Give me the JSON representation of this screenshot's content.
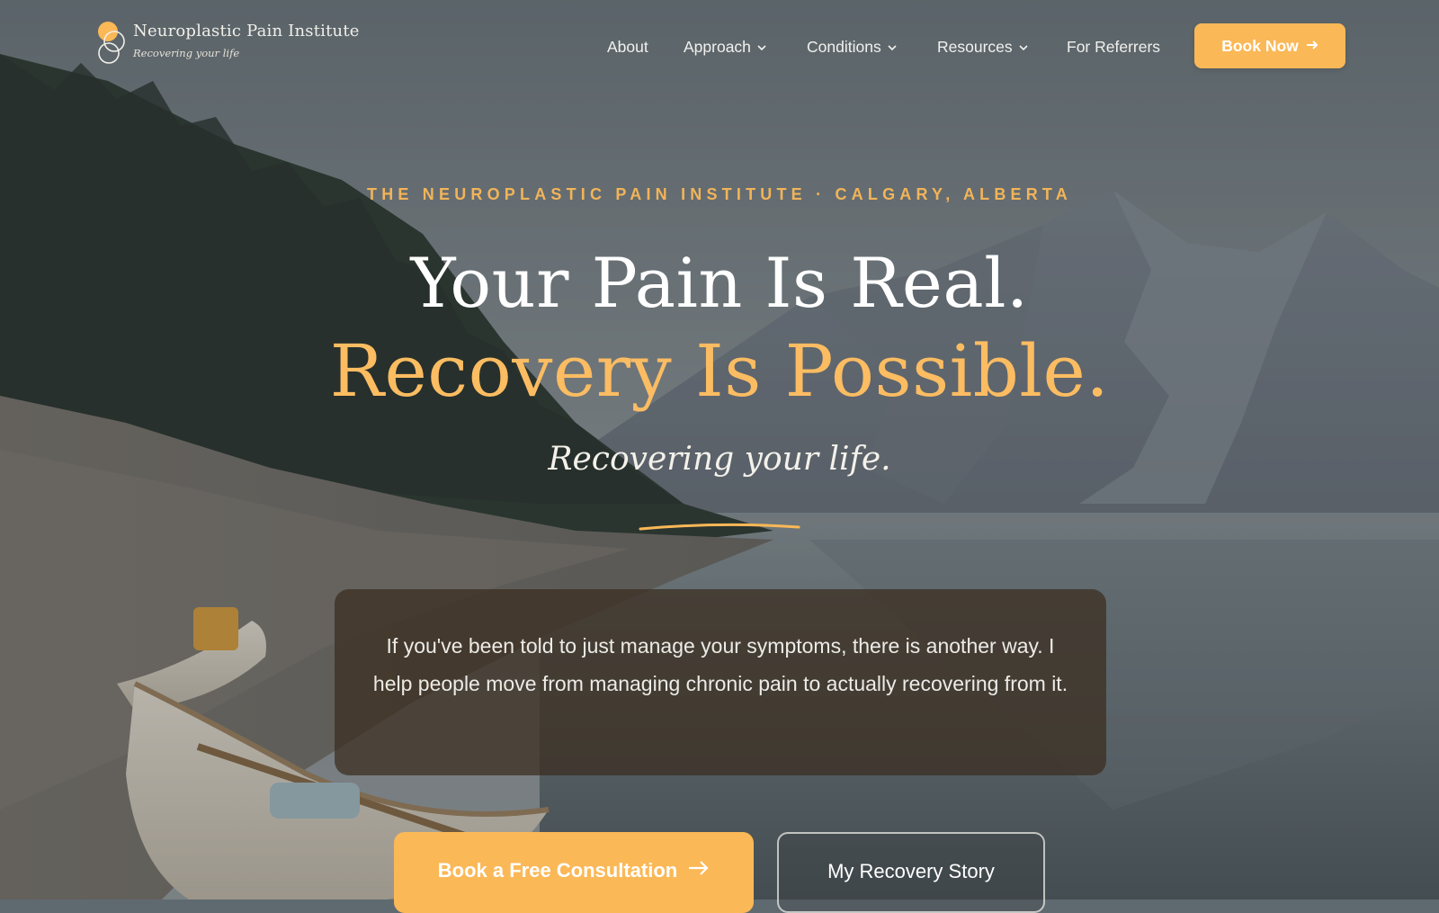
{
  "brand": {
    "name": "Neuroplastic Pain Institute",
    "tagline": "Recovering your life",
    "logo_colors": [
      "#fbb857",
      "#f1efe9"
    ]
  },
  "nav": {
    "items": [
      {
        "label": "About",
        "has_dropdown": false
      },
      {
        "label": "Approach",
        "has_dropdown": true
      },
      {
        "label": "Conditions",
        "has_dropdown": true
      },
      {
        "label": "Resources",
        "has_dropdown": true
      },
      {
        "label": "For Referrers",
        "has_dropdown": false
      }
    ],
    "book_now_label": "Book Now",
    "book_now_icon": "arrow-right-icon"
  },
  "hero": {
    "eyebrow": "THE NEUROPLASTIC PAIN INSTITUTE · CALGARY, ALBERTA",
    "headline_line1": "Your Pain Is Real.",
    "headline_line2": "Recovery Is Possible.",
    "tagline": "Recovering your life.",
    "intro": "If you've been told to just manage your symptoms, there is another way. I help people move from managing chronic pain to actually recovering from it.",
    "primary_cta": "Book a Free Consultation",
    "primary_cta_icon": "arrow-right-icon",
    "secondary_cta": "My Recovery Story"
  },
  "colors": {
    "accent": "#fbb857",
    "accent_text": "#f2b458",
    "headline": "#ffffff",
    "card_bg": "rgba(58,44,30,0.72)"
  }
}
